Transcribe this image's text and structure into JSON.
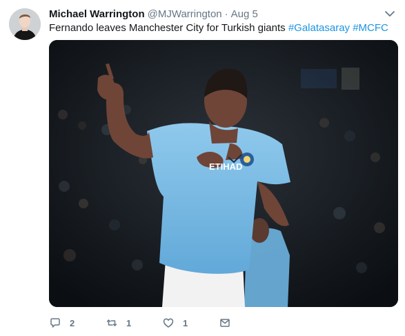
{
  "author": {
    "display_name": "Michael Warrington",
    "handle": "@MJWarrington",
    "date": "Aug 5",
    "separator": "·"
  },
  "tweet": {
    "text": "Fernando leaves Manchester City for Turkish giants ",
    "hashtags": [
      "#Galatasaray",
      "#MCFC"
    ]
  },
  "media": {
    "description_icon": "photo",
    "jersey_sponsor": "ETIHAD"
  },
  "actions": {
    "reply_count": "2",
    "retweet_count": "1",
    "like_count": "1"
  },
  "icons": {
    "reply": "reply-icon",
    "retweet": "retweet-icon",
    "like": "heart-icon",
    "message": "envelope-icon",
    "more": "chevron-down-icon"
  },
  "colors": {
    "link": "#1b95e0",
    "meta": "#657786",
    "text": "#14171a"
  }
}
